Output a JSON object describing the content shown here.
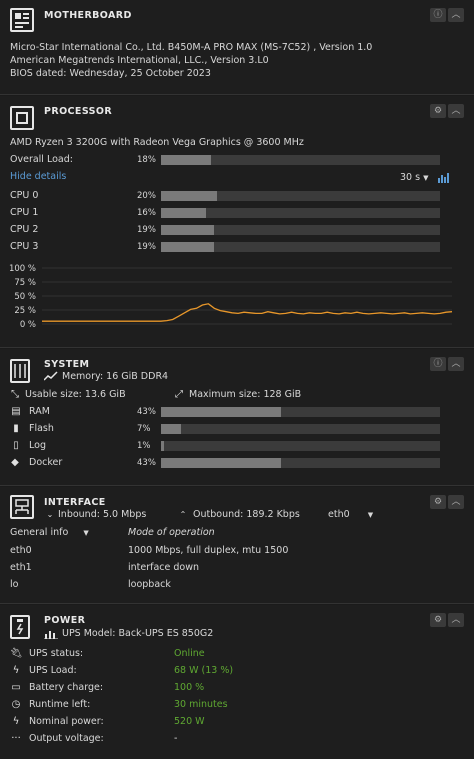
{
  "motherboard": {
    "title": "MOTHERBOARD",
    "lines": [
      "Micro-Star International Co., Ltd. B450M-A PRO MAX (MS-7C52) , Version 1.0",
      "American Megatrends International, LLC., Version 3.L0",
      "BIOS dated: Wednesday, 25 October 2023"
    ]
  },
  "processor": {
    "title": "PROCESSOR",
    "model": "AMD Ryzen 3 3200G with Radeon Vega Graphics @ 3600 MHz",
    "overall_label": "Overall Load:",
    "overall_pct": "18%",
    "overall_value": 18,
    "hide_details": "Hide details",
    "interval": "30 s",
    "cpus": [
      {
        "label": "CPU 0",
        "pct": "20%",
        "value": 20
      },
      {
        "label": "CPU 1",
        "pct": "16%",
        "value": 16
      },
      {
        "label": "CPU 2",
        "pct": "19%",
        "value": 19
      },
      {
        "label": "CPU 3",
        "pct": "19%",
        "value": 19
      }
    ]
  },
  "chart_data": {
    "type": "line",
    "ylabels": [
      "100 %",
      "75 %",
      "50 %",
      "25 %",
      "0 %"
    ],
    "ylim": [
      0,
      100
    ],
    "grid": true,
    "series": [
      {
        "color": "#e8972a",
        "values": [
          5,
          5,
          5,
          5,
          5,
          5,
          5,
          5,
          5,
          5,
          5,
          5,
          5,
          5,
          5,
          5,
          5,
          5,
          5,
          5,
          5,
          6,
          8,
          14,
          20,
          26,
          28,
          34,
          36,
          28,
          24,
          22,
          20,
          19,
          21,
          20,
          19,
          19,
          22,
          20,
          18,
          19,
          21,
          19,
          18,
          20,
          19,
          19,
          21,
          19,
          18,
          20,
          19,
          21,
          19,
          18,
          19,
          20,
          19,
          18,
          19,
          20,
          18,
          19,
          20,
          19,
          18,
          19,
          21,
          22
        ]
      }
    ]
  },
  "system": {
    "title": "SYSTEM",
    "memory": "Memory: 16 GiB DDR4",
    "usable": "Usable size: 13.6 GiB",
    "maximum": "Maximum size: 128 GiB",
    "items": [
      {
        "label": "RAM",
        "pct": "43%",
        "value": 43
      },
      {
        "label": "Flash",
        "pct": "7%",
        "value": 7
      },
      {
        "label": "Log",
        "pct": "1%",
        "value": 1
      },
      {
        "label": "Docker",
        "pct": "43%",
        "value": 43
      }
    ]
  },
  "interface": {
    "title": "INTERFACE",
    "inbound": "Inbound: 5.0 Mbps",
    "outbound": "Outbound: 189.2 Kbps",
    "iface": "eth0",
    "col1_header": "General info",
    "col2_header": "Mode of operation",
    "rows": [
      {
        "name": "eth0",
        "info": "1000 Mbps, full duplex, mtu 1500"
      },
      {
        "name": "eth1",
        "info": "interface down"
      },
      {
        "name": "lo",
        "info": "loopback"
      }
    ]
  },
  "power": {
    "title": "POWER",
    "model": "UPS Model: Back-UPS ES 850G2",
    "rows": [
      {
        "label": "UPS status:",
        "value": "Online",
        "icon": "plug-icon"
      },
      {
        "label": "UPS Load:",
        "value": "68 W (13 %)",
        "icon": "lightning-icon"
      },
      {
        "label": "Battery charge:",
        "value": "100 %",
        "icon": "battery-icon"
      },
      {
        "label": "Runtime left:",
        "value": "30 minutes",
        "icon": "clock-icon"
      },
      {
        "label": "Nominal power:",
        "value": "520 W",
        "icon": "lightning-icon"
      },
      {
        "label": "Output voltage:",
        "value": "-",
        "icon": "dots-icon"
      }
    ]
  }
}
